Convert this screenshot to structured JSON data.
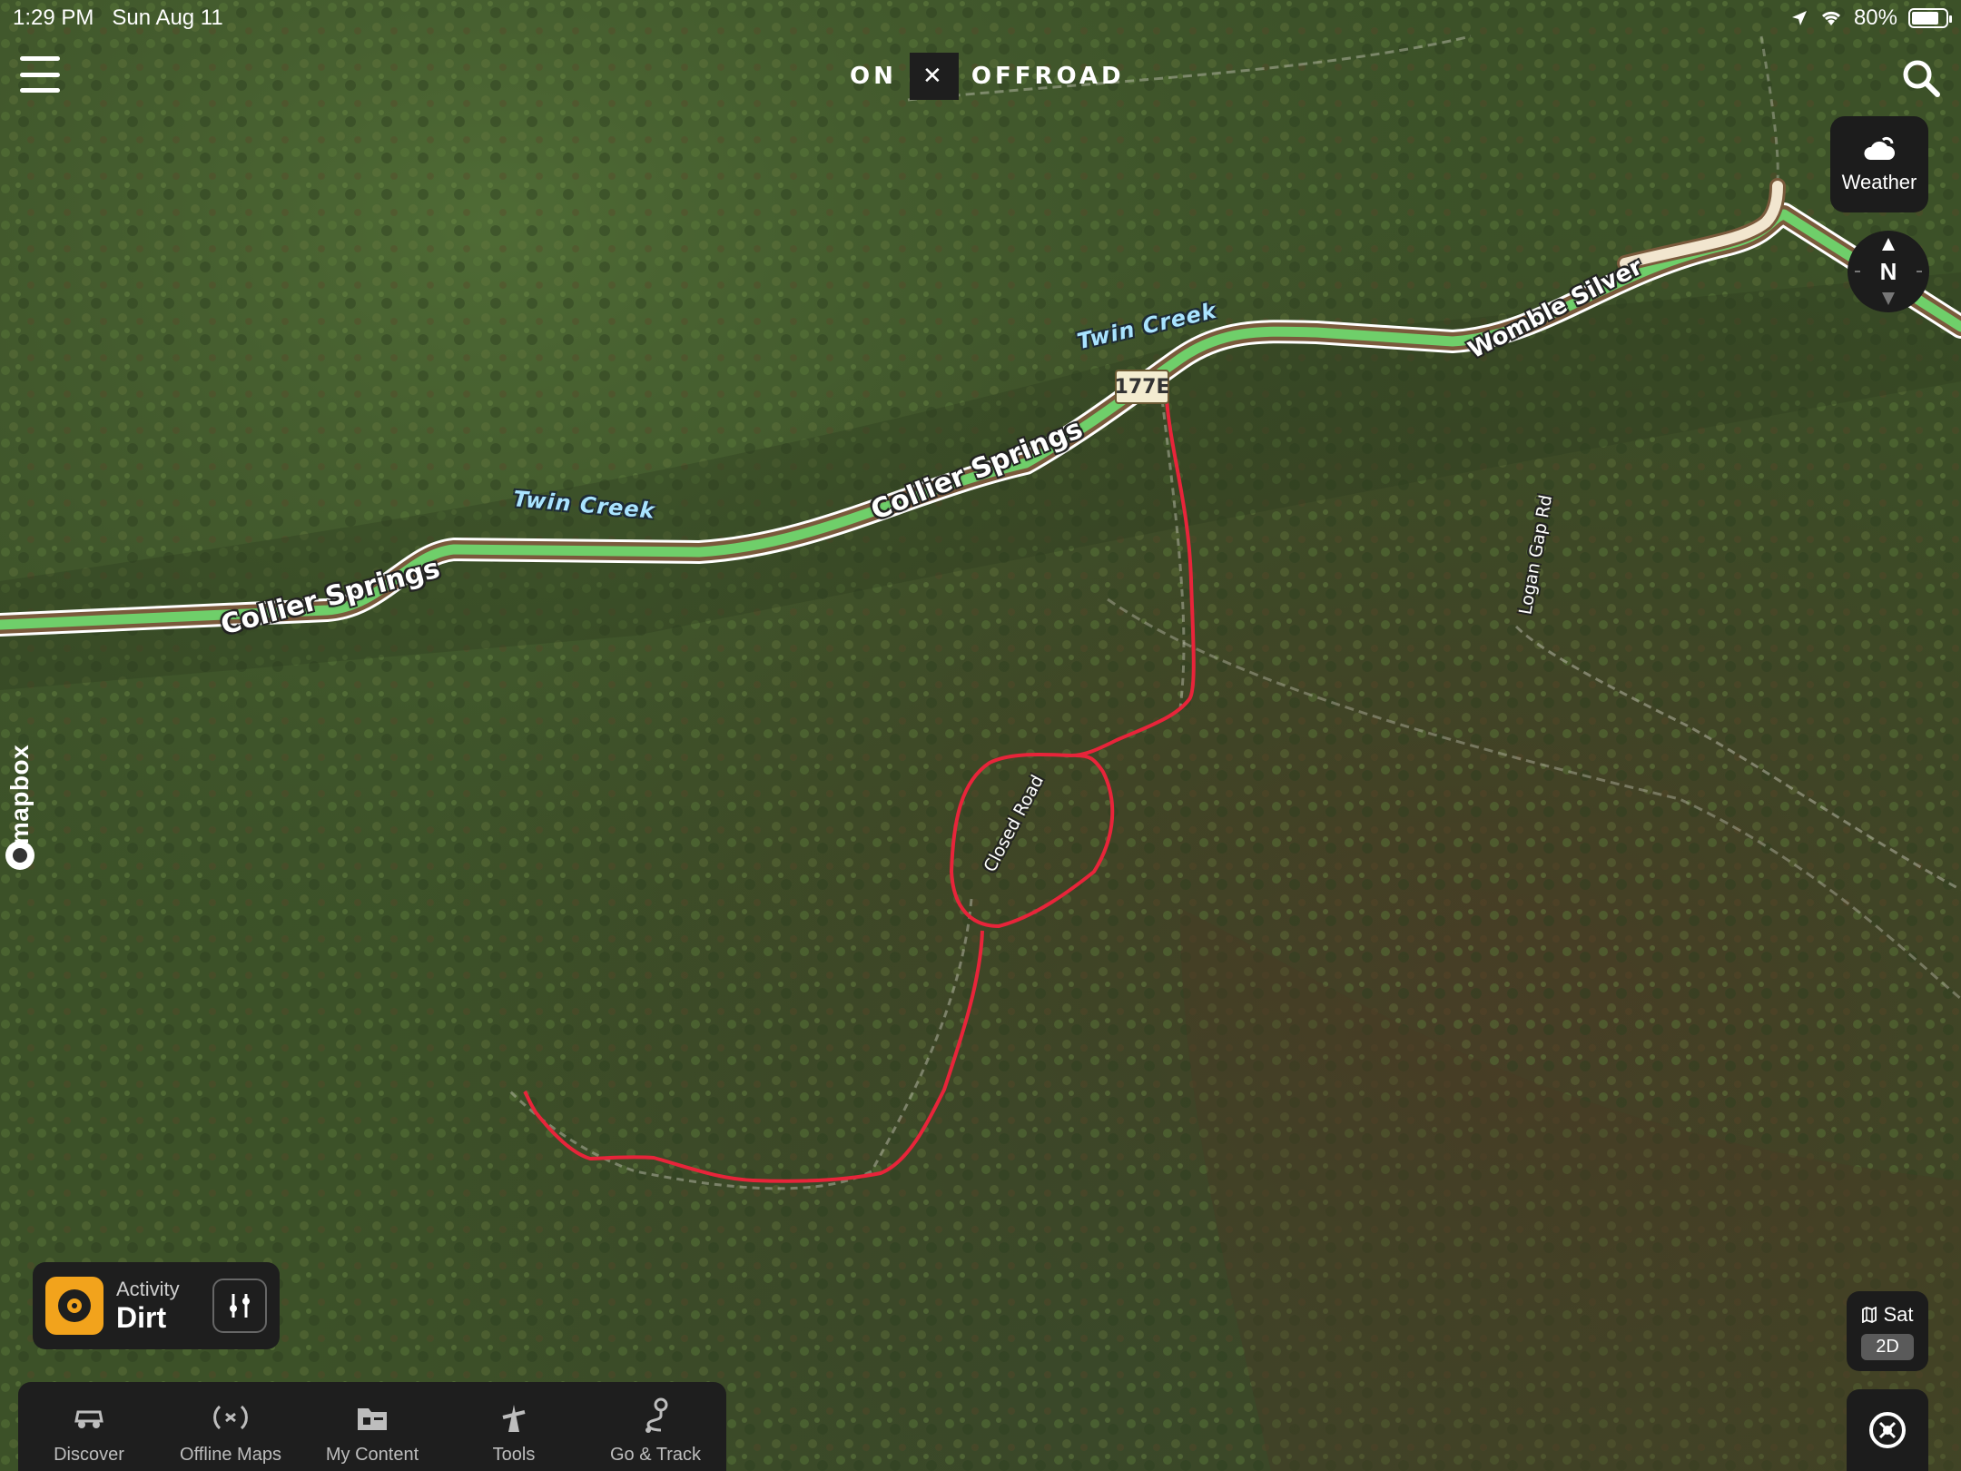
{
  "status_bar": {
    "time": "1:29 PM",
    "date": "Sun Aug 11",
    "battery": "80%",
    "battery_level": 0.8
  },
  "header": {
    "logo_left": "ON",
    "logo_x": "✕",
    "logo_right": "OFFROAD"
  },
  "controls": {
    "weather_label": "Weather",
    "compass_label": "N",
    "layer_label": "Sat",
    "layer_mode": "2D"
  },
  "attribution": "mapbox",
  "map": {
    "roads": [
      {
        "name": "Collier Springs",
        "id": "road-label-collier-springs-west"
      },
      {
        "name": "Collier Springs",
        "id": "road-label-collier-springs-east"
      },
      {
        "name": "Womble Silver",
        "id": "road-label-womble-silver"
      }
    ],
    "waterways": [
      "Twin Creek",
      "Twin Creek"
    ],
    "trails": [
      "Closed Road",
      "Logan Gap Rd"
    ],
    "route_shield": "177E",
    "colors": {
      "road_fill": "#6fcf6a",
      "road_casing": "#7a5a3c",
      "highlight_route": "#e8243a",
      "dirt_road": "#f2e6cf"
    }
  },
  "activity": {
    "label": "Activity",
    "value": "Dirt",
    "icon": "dirt-tire-icon",
    "accent": "#f2a31c"
  },
  "tabs": [
    {
      "label": "Discover",
      "icon": "discover-jeep-icon"
    },
    {
      "label": "Offline Maps",
      "icon": "offline-maps-icon"
    },
    {
      "label": "My Content",
      "icon": "my-content-icon"
    },
    {
      "label": "Tools",
      "icon": "tools-icon"
    },
    {
      "label": "Go & Track",
      "icon": "go-track-icon"
    }
  ]
}
